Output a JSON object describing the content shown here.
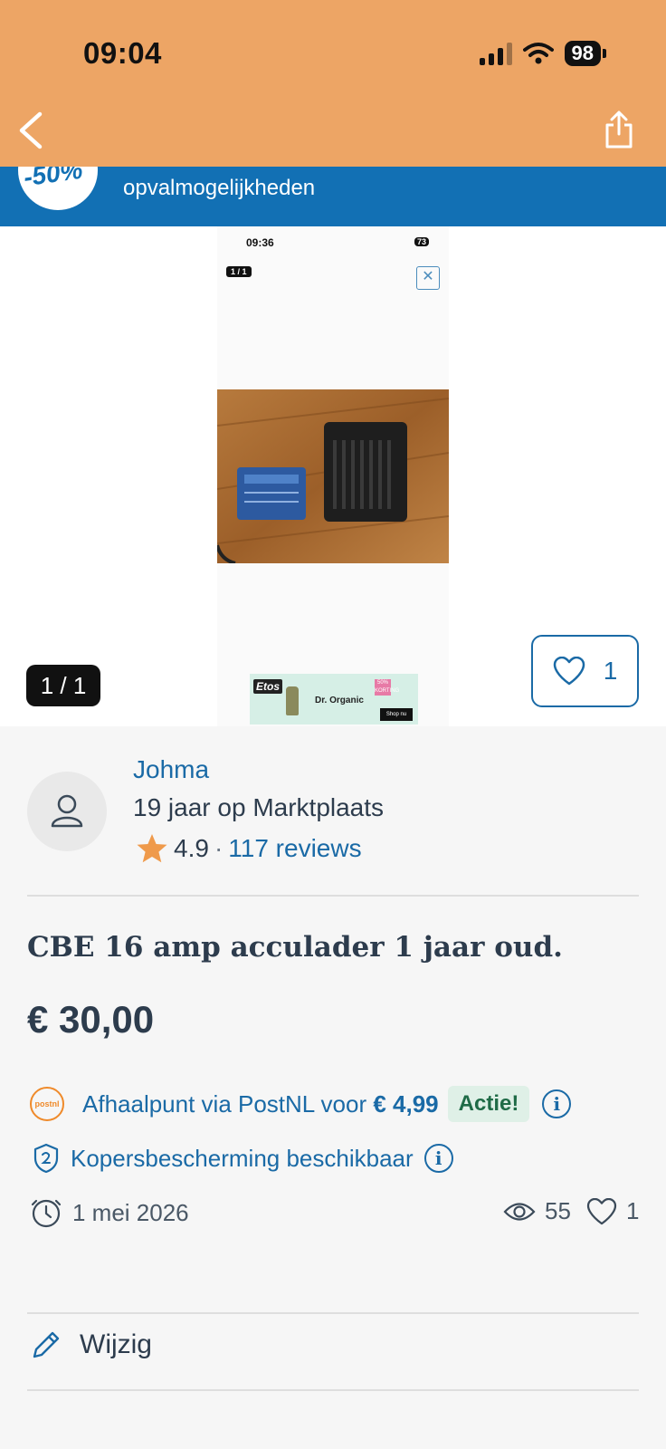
{
  "status_bar": {
    "time": "09:04",
    "battery": "98"
  },
  "banner": {
    "badge": "-50%",
    "text": "opvalmogelijkheden"
  },
  "screenshot": {
    "time": "09:36",
    "battery": "73",
    "counter": "1 / 1",
    "ad": {
      "brand": "Etos",
      "product": "Dr. Organic",
      "promo": "50% KORTING",
      "cta": "Shop nu"
    }
  },
  "gallery": {
    "counter": "1 / 1",
    "favorite_count": "1"
  },
  "seller": {
    "name": "Johma",
    "since": "19 jaar op Marktplaats",
    "rating": "4.9",
    "separator": "·",
    "reviews": "117 reviews"
  },
  "listing": {
    "title": "CBE 16 amp acculader 1 jaar oud.",
    "price": "€ 30,00"
  },
  "shipping": {
    "postnl_logo": "postnl",
    "text": "Afhaalpunt via PostNL voor",
    "price": "€ 4,99",
    "badge": "Actie!"
  },
  "protection": {
    "text": "Kopersbescherming beschikbaar"
  },
  "meta": {
    "date": "1 mei 2026",
    "views": "55",
    "favorites": "1"
  },
  "actions": {
    "edit": "Wijzig"
  },
  "colors": {
    "topbar": "#eda565",
    "banner": "#1270b4",
    "link": "#1a6aa6",
    "text": "#2d3c4d",
    "star": "#ef9a4b",
    "actie_bg": "#dff0e7"
  }
}
